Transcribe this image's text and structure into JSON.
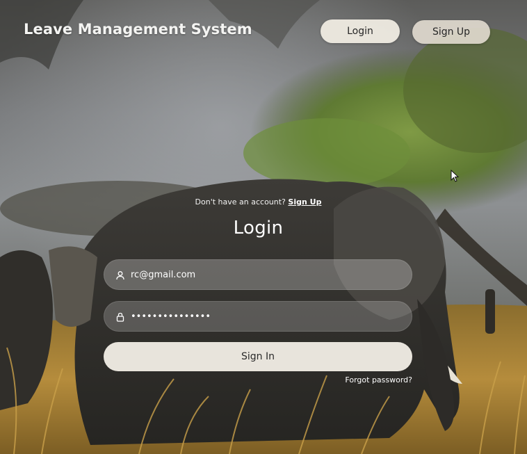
{
  "header": {
    "app_title": "Leave Management System",
    "login_label": "Login",
    "signup_label": "Sign Up"
  },
  "form": {
    "signup_prompt": "Don't have an account?",
    "signup_link": "Sign Up",
    "title": "Login",
    "email_value": "rc@gmail.com",
    "email_icon": "user-icon",
    "password_value": "•••••••••••••••",
    "password_icon": "lock-icon",
    "signin_label": "Sign In",
    "forgot_label": "Forgot password?"
  },
  "background": {
    "description_icon": "elephant-savanna-photo",
    "sky_color": "#8c8f93",
    "grass_color": "#b08a3a",
    "foliage_color": "#6e8a3c"
  }
}
